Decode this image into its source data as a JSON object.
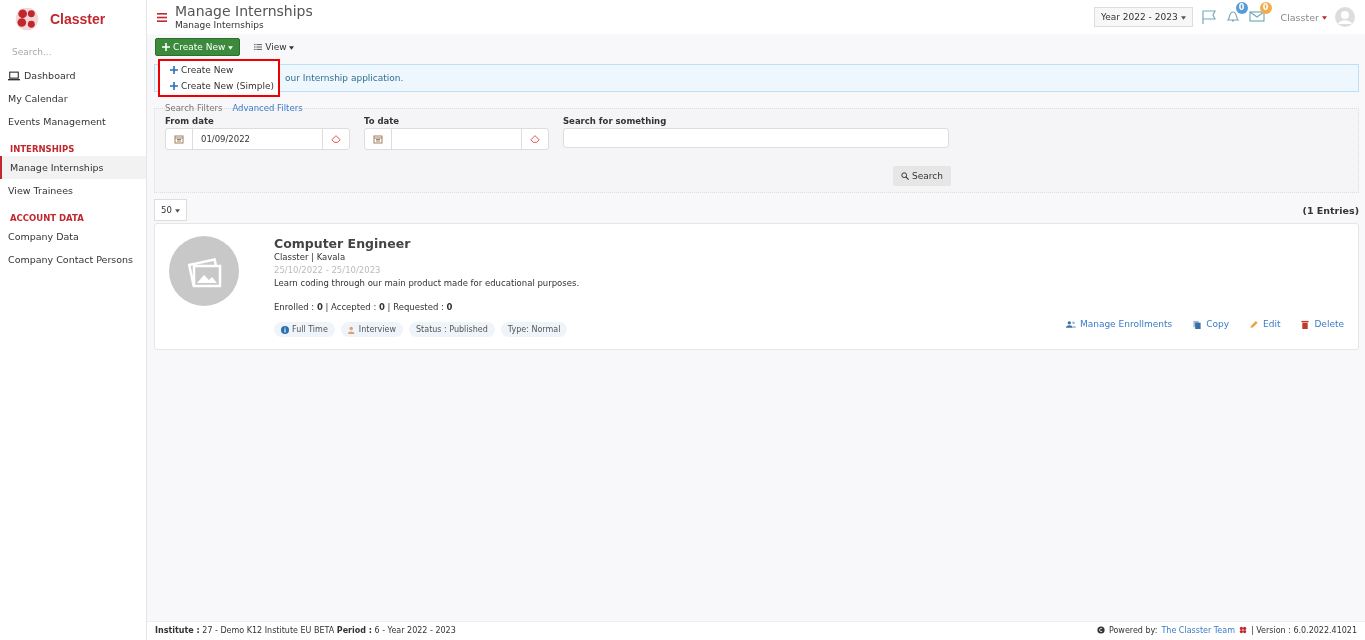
{
  "brand": {
    "name": "Classter"
  },
  "sidebar": {
    "search_placeholder": "Search...",
    "items": [
      {
        "kind": "item",
        "label": "Dashboard",
        "selected": false
      },
      {
        "kind": "item",
        "label": "My Calendar",
        "selected": false
      },
      {
        "kind": "item",
        "label": "Events Management",
        "selected": false
      },
      {
        "kind": "heading",
        "label": "INTERNSHIPS"
      },
      {
        "kind": "item",
        "label": "Manage Internships",
        "selected": true
      },
      {
        "kind": "item",
        "label": "View Trainees",
        "selected": false
      },
      {
        "kind": "heading",
        "label": "ACCOUNT DATA"
      },
      {
        "kind": "item",
        "label": "Company Data",
        "selected": false
      },
      {
        "kind": "item",
        "label": "Company Contact Persons",
        "selected": false
      }
    ]
  },
  "header": {
    "title": "Manage Internships",
    "subtitle": "Manage Internships",
    "year": "Year 2022 - 2023",
    "notifications": "0",
    "messages": "0",
    "user": "Classter"
  },
  "toolbar": {
    "create": "Create New",
    "view": "View"
  },
  "create_menu": {
    "items": [
      "Create New",
      "Create New (Simple)"
    ]
  },
  "banner": "our Internship application.",
  "filters": {
    "legend": "Search Filters",
    "advanced": "Advanced Filters",
    "from_label": "From date",
    "from_value": "01/09/2022",
    "to_label": "To date",
    "search_label": "Search for something",
    "search_button": "Search"
  },
  "page_size": "50",
  "entries": "(1 Entries)",
  "internships": [
    {
      "title": "Computer Engineer",
      "company": "Classter | Kavala",
      "dates": "25/10/2022 - 25/10/2023",
      "description": "Learn coding through our main product made for educational purposes.",
      "stats": "Enrolled : **0** | Accepted : **0** | Requested : **0**",
      "tags": [
        {
          "kind": "info",
          "label": "Full Time"
        },
        {
          "kind": "person",
          "label": "Interview"
        },
        {
          "kind": "plain",
          "label": "Status : Published"
        },
        {
          "kind": "plain",
          "label": "Type: Normal"
        }
      ],
      "actions": [
        {
          "kind": "enroll",
          "label": "Manage Enrollments"
        },
        {
          "kind": "copy",
          "label": "Copy"
        },
        {
          "kind": "edit",
          "label": "Edit"
        },
        {
          "kind": "delete",
          "label": "Delete"
        }
      ]
    }
  ],
  "footer": {
    "institute_label": "Institute :",
    "institute": "27 - Demo K12 Institute EU BETA",
    "period_label": "Period :",
    "period": "6 - Year 2022 - 2023",
    "powered": "Powered by:",
    "team": "The Classter Team",
    "version": "| Version : 6.0.2022.41021"
  }
}
